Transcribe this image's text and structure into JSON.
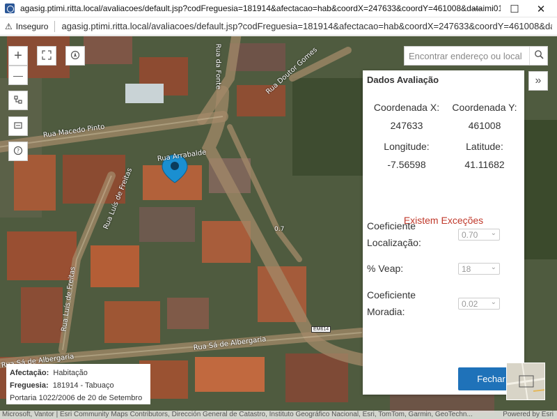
{
  "window": {
    "title": "agasig.ptimi.ritta.local/avaliacoes/default.jsp?codFreguesia=181914&afectacao=hab&coordX=247633&coordY=461008&dataimi01=2007-09-2...",
    "minimize": "—",
    "maximize": "☐",
    "close": "✕"
  },
  "addressbar": {
    "security_label": "Inseguro",
    "url": "agasig.ptimi.ritta.local/avaliacoes/default.jsp?codFreguesia=181914&afectacao=hab&coordX=247633&coordY=461008&dataimi0..."
  },
  "map": {
    "zoom_in": "+",
    "zoom_out": "—",
    "search_placeholder": "Encontrar endereço ou local",
    "road_labels": {
      "macedo_pinto": "Rua Macedo Pinto",
      "arrabalde": "Rua Arrabalde",
      "luis_freitas_upper": "Rua Luís de Freitas",
      "luis_freitas_lower": "Rua Luís de Freitas",
      "sa_albergaria": "Rua Sá de Albergaria",
      "sa_albergaria_left": "Rua Sá de Albergaria",
      "doutor_gomes": "Rua Doutor Gomes",
      "da_fonte": "Rua da Fonte"
    },
    "road_shield": "EM614",
    "distance_label": "0.7"
  },
  "panel": {
    "title": "Dados Avaliação",
    "coord_x_label": "Coordenada X:",
    "coord_y_label": "Coordenada Y:",
    "coord_x_value": "247633",
    "coord_y_value": "461008",
    "longitude_label": "Longitude:",
    "latitude_label": "Latitude:",
    "longitude_value": "-7.56598",
    "latitude_value": "41.11682",
    "exceptions": "Existem Exceções",
    "coef_localizacao_label_1": "Coeficiente",
    "coef_localizacao_label_2": "Localização:",
    "coef_localizacao_value": "0.70",
    "veap_label": "% Veap:",
    "veap_value": "18",
    "coef_moradia_label_1": "Coeficiente",
    "coef_moradia_label_2": "Moradia:",
    "coef_moradia_value": "0.02",
    "close_button": "Fechar"
  },
  "infobox": {
    "afectacao_label": "Afectação:",
    "afectacao_value": "Habitação",
    "freguesia_label": "Freguesia:",
    "freguesia_value": "181914 - Tabuaço",
    "portaria": "Portaria 1022/2006 de 20 de Setembro"
  },
  "attribution": {
    "sources": "Microsoft, Vantor | Esri Community Maps Contributors, Dirección General de Catastro, Instituto Geográfico Nacional, Esri, TomTom, Garmin, GeoTechn...",
    "powered_by": "Powered by Esri"
  },
  "colors": {
    "accent": "#1f72b9",
    "exception": "#c0392b",
    "pin": "#1a8fd1"
  }
}
